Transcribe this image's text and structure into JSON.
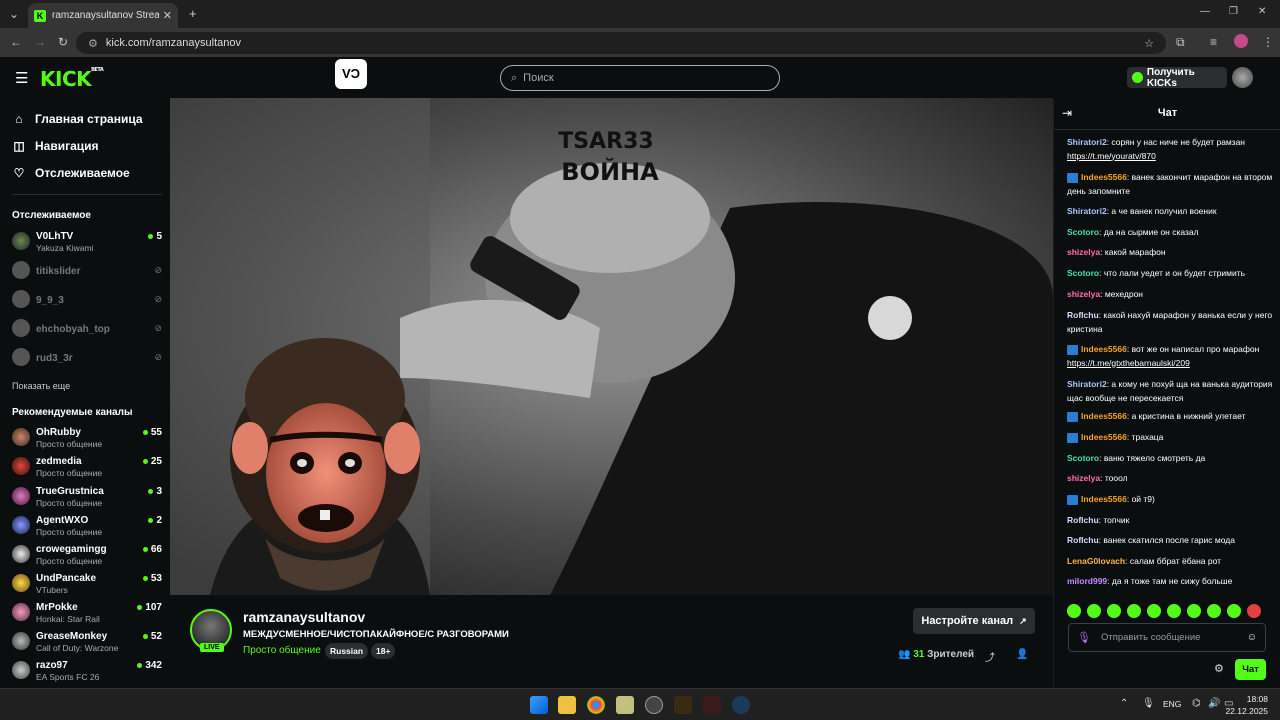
{
  "browser": {
    "tab_title": "ramzanaysultanov Stream - Wa",
    "url": "kick.com/ramzanaysultanov"
  },
  "header": {
    "logo": "KICK",
    "logo_sup": "BETA",
    "badge": "VƆ",
    "search_placeholder": "Поиск",
    "get_kicks": "Получить KICKs"
  },
  "sidebar": {
    "nav": [
      {
        "label": "Главная страница",
        "icon": "home-icon"
      },
      {
        "label": "Навигация",
        "icon": "compass-icon"
      },
      {
        "label": "Отслеживаемое",
        "icon": "heart-icon"
      }
    ],
    "followed_title": "Отслеживаемое",
    "followed": [
      {
        "name": "V0LhTV",
        "sub": "Yakuza Kiwami",
        "viewers": "5",
        "online": true
      },
      {
        "name": "titikslider",
        "online": false
      },
      {
        "name": "9_9_3",
        "online": false
      },
      {
        "name": "ehchobyah_top",
        "online": false
      },
      {
        "name": "rud3_3r",
        "online": false
      }
    ],
    "show_more": "Показать еще",
    "recommended_title": "Рекомендуемые каналы",
    "recommended": [
      {
        "name": "OhRubby",
        "sub": "Просто общение",
        "viewers": "55"
      },
      {
        "name": "zedmedia",
        "sub": "Просто общение",
        "viewers": "25"
      },
      {
        "name": "TrueGrustnica",
        "sub": "Просто общение",
        "viewers": "3"
      },
      {
        "name": "AgentWXO",
        "sub": "Просто общение",
        "viewers": "2"
      },
      {
        "name": "crowegamingg",
        "sub": "Просто общение",
        "viewers": "66"
      },
      {
        "name": "UndPancake",
        "sub": "VTubers",
        "viewers": "53"
      },
      {
        "name": "MrPokke",
        "sub": "Honkai: Star Rail",
        "viewers": "107"
      },
      {
        "name": "GreaseMonkey",
        "sub": "Call of Duty: Warzone",
        "viewers": "52"
      },
      {
        "name": "razo97",
        "sub": "EA Sports FC 26",
        "viewers": "342"
      }
    ]
  },
  "player": {
    "overlay_text_1": "TSAR33",
    "overlay_text_2": "ВОЙНА"
  },
  "channel": {
    "name": "ramzanaysultanov",
    "title": "МЕЖДУСМЕННОЕ/ЧИСТОПАКАЙФНОЕ/С РАЗГОВОРАМИ",
    "category": "Просто общение",
    "tags": [
      "Russian",
      "18+"
    ],
    "live": "LIVE",
    "setup_button": "Настройте канал",
    "viewers_count": "31",
    "viewers_label": "Зрителей"
  },
  "chat": {
    "title": "Чат",
    "messages": [
      {
        "user": "Shiratori2",
        "color": "#a9c6ff",
        "text": "сорян у нас ниче не будет рамзан",
        "link": "https://t.me/youratv/870",
        "badge": false
      },
      {
        "user": "Indees5566",
        "color": "#f5a623",
        "text": "ванек закончит марафон на втором день запомните",
        "badge": true
      },
      {
        "user": "Shiratori2",
        "color": "#a9c6ff",
        "text": "а че ванек получил военик",
        "badge": false
      },
      {
        "user": "Scotoro",
        "color": "#4be0a8",
        "text": "да на сырмие он сказал",
        "badge": false
      },
      {
        "user": "shizelya",
        "color": "#ff6fa8",
        "text": "какой марафон",
        "badge": false
      },
      {
        "user": "Scotoro",
        "color": "#4be0a8",
        "text": "что лали уедет и он будет стримить",
        "badge": false
      },
      {
        "user": "shizelya",
        "color": "#ff6fa8",
        "text": "мехедрон",
        "badge": false
      },
      {
        "user": "Roflchu",
        "color": "#d9d9ff",
        "text": "какой нахуй марафон у ванька если у него кристина",
        "badge": false
      },
      {
        "user": "Indees5566",
        "color": "#f5a623",
        "text": "вот же он написал про марафон",
        "link": "https://t.me/gtxthebarnaulski/209",
        "badge": true
      },
      {
        "user": "Shiratori2",
        "color": "#a9c6ff",
        "text": "а кому не похуй ща на ванька аудитория щас вообще не пересекается",
        "badge": false
      },
      {
        "user": "Indees5566",
        "color": "#f5a623",
        "text": "а кристина в нижний улетает",
        "badge": true
      },
      {
        "user": "Indees5566",
        "color": "#f5a623",
        "text": "трахаца",
        "badge": true
      },
      {
        "user": "Scotoro",
        "color": "#4be0a8",
        "text": "ваню тяжело смотреть да",
        "badge": false
      },
      {
        "user": "shizelya",
        "color": "#ff6fa8",
        "text": "тооол",
        "badge": false
      },
      {
        "user": "Indees5566",
        "color": "#f5a623",
        "text": "ой т9)",
        "badge": true
      },
      {
        "user": "Roflchu",
        "color": "#d9d9ff",
        "text": "топчик",
        "badge": false
      },
      {
        "user": "Roflchu",
        "color": "#d9d9ff",
        "text": "ванек скатился после гарис мода",
        "badge": false
      },
      {
        "user": "LenaG0lovach",
        "color": "#ffb347",
        "text": "салам ббрат ёбана рот",
        "badge": false
      },
      {
        "user": "milord999",
        "color": "#c58cff",
        "text": "да я тоже там не сижу больше",
        "badge": false
      }
    ],
    "input_placeholder": "Отправить сообщение",
    "send_button": "Чат"
  },
  "taskbar": {
    "lang": "ENG",
    "time": "18:08",
    "date": "22.12.2025"
  },
  "colors": {
    "accent": "#53fc18",
    "bg": "#0b0e0f"
  }
}
